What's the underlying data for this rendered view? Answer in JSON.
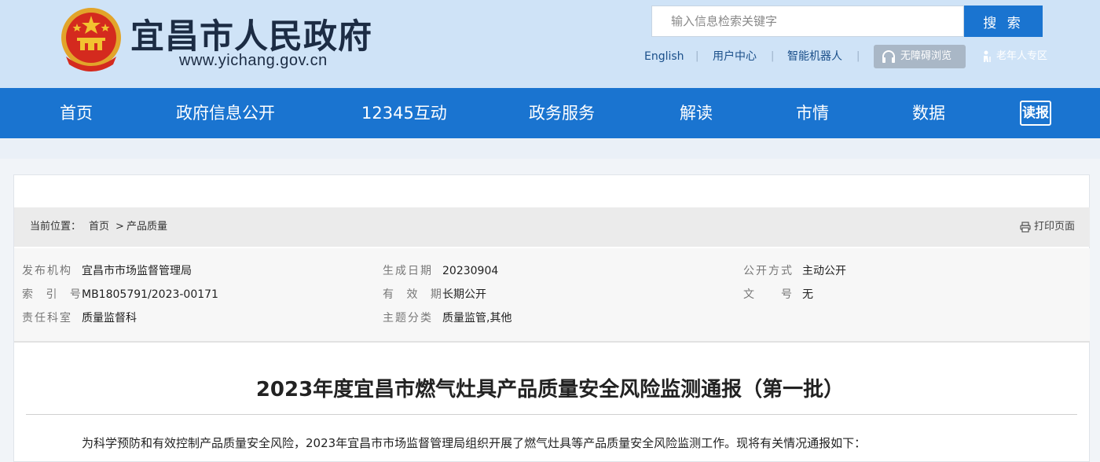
{
  "header": {
    "site_title": "宜昌市人民政府",
    "site_url": "www.yichang.gov.cn",
    "search": {
      "placeholder": "输入信息检索关键字",
      "button_label": "搜 索"
    },
    "links": {
      "english": "English",
      "user_center": "用户中心",
      "robot": "智能机器人",
      "separator": "|"
    },
    "accessibility_label": "无障碍浏览",
    "elder_label": "老年人专区"
  },
  "nav": {
    "items": [
      "首页",
      "政府信息公开",
      "12345互动",
      "政务服务",
      "解读",
      "市情",
      "数据"
    ],
    "read_label": "读报"
  },
  "breadcrumb": {
    "prefix": "当前位置：",
    "home": "首页",
    "arrow": ">",
    "current": "产品质量"
  },
  "print_label": "打印页面",
  "meta": {
    "publisher_label": "发布机构",
    "publisher": "宜昌市市场监督管理局",
    "date_label": "生成日期",
    "date": "20230904",
    "disclosure_label": "公开方式",
    "disclosure": "主动公开",
    "index_label": "索 引 号",
    "index": "MB1805791/2023-00171",
    "validity_label": "有 效 期",
    "validity": "长期公开",
    "docno_label": "文　　号",
    "docno": "无",
    "dept_label": "责任科室",
    "dept": "质量监督科",
    "topic_label": "主题分类",
    "topic": "质量监管,其他"
  },
  "article": {
    "title": "2023年度宜昌市燃气灶具产品质量安全风险监测通报（第一批）",
    "paragraph": "为科学预防和有效控制产品质量安全风险，2023年宜昌市市场监督管理局组织开展了燃气灶具等产品质量安全风险监测工作。现将有关情况通报如下："
  },
  "colors": {
    "nav_blue": "#1a74d0",
    "header_bg": "#cfe3f7",
    "emblem_red": "#d42a1e",
    "emblem_gold": "#f2c230"
  }
}
